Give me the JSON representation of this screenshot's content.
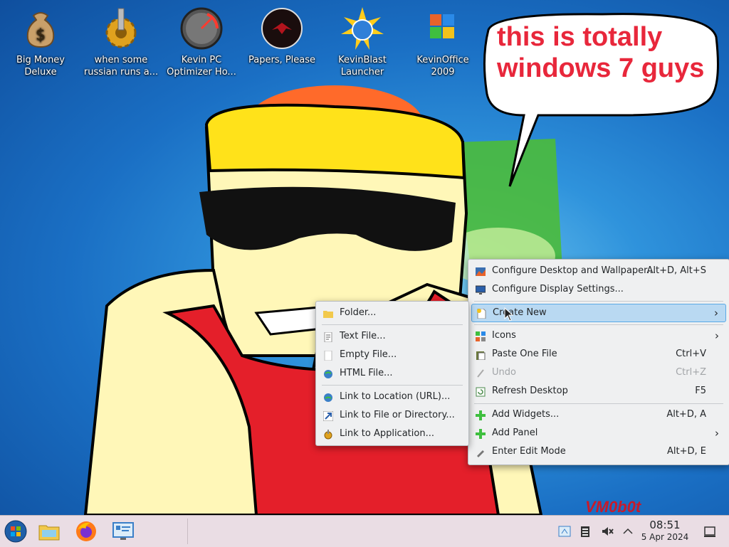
{
  "desktop": {
    "icons": [
      {
        "label": "Big Money\nDeluxe",
        "icon": "money-bag-icon"
      },
      {
        "label": "when some\nrussian runs a...",
        "icon": "gear-icon"
      },
      {
        "label": "Kevin PC\nOptimizer Ho...",
        "icon": "speedometer-icon"
      },
      {
        "label": "Papers, Please",
        "icon": "papers-please-icon"
      },
      {
        "label": "KevinBlast\nLauncher",
        "icon": "globe-burst-icon"
      },
      {
        "label": "KevinOffice\n2009",
        "icon": "office-logo-icon"
      }
    ],
    "speech_bubble": "this is totally\nwindows 7 guys",
    "watermark": "VM0b0t"
  },
  "context_menu": {
    "items": [
      {
        "label": "Configure Desktop and Wallpaper...",
        "shortcut": "Alt+D, Alt+S",
        "icon": "wallpaper-icon"
      },
      {
        "label": "Configure Display Settings...",
        "shortcut": "",
        "icon": "display-icon"
      },
      {
        "label": "Create New",
        "shortcut": "",
        "icon": "create-new-icon",
        "submenu": true
      },
      {
        "label": "Icons",
        "shortcut": "",
        "icon": "icons-icon",
        "submenu": true
      },
      {
        "label": "Paste One File",
        "shortcut": "Ctrl+V",
        "icon": "paste-icon"
      },
      {
        "label": "Undo",
        "shortcut": "Ctrl+Z",
        "icon": "undo-icon",
        "disabled": true
      },
      {
        "label": "Refresh Desktop",
        "shortcut": "F5",
        "icon": "refresh-icon"
      },
      {
        "label": "Add Widgets...",
        "shortcut": "Alt+D, A",
        "icon": "plus-icon"
      },
      {
        "label": "Add Panel",
        "shortcut": "",
        "icon": "plus-icon",
        "submenu": true
      },
      {
        "label": "Enter Edit Mode",
        "shortcut": "Alt+D, E",
        "icon": "edit-icon"
      }
    ],
    "submenu_arrow": "›"
  },
  "create_new_submenu": {
    "items": [
      {
        "label": "Folder...",
        "icon": "folder-icon"
      },
      {
        "label": "Text File...",
        "icon": "text-file-icon"
      },
      {
        "label": "Empty File...",
        "icon": "empty-file-icon"
      },
      {
        "label": "HTML File...",
        "icon": "html-file-icon"
      },
      {
        "label": "Link to Location (URL)...",
        "icon": "link-url-icon"
      },
      {
        "label": "Link to File or Directory...",
        "icon": "link-file-icon"
      },
      {
        "label": "Link to Application...",
        "icon": "link-app-icon"
      }
    ]
  },
  "taskbar": {
    "pinned": [
      "start-orb-icon",
      "file-manager-icon",
      "firefox-icon",
      "system-settings-icon"
    ],
    "tray": [
      "network-icon",
      "clipboard-icon",
      "volume-muted-icon",
      "tray-expand-icon"
    ],
    "time": "08:51",
    "date": "5 Apr 2024",
    "colors": {
      "taskbar_bg": "#e8dae2",
      "menu_bg": "#eff0f1",
      "highlight": "#b9d9f2",
      "bubble_text": "#e8273b"
    }
  }
}
